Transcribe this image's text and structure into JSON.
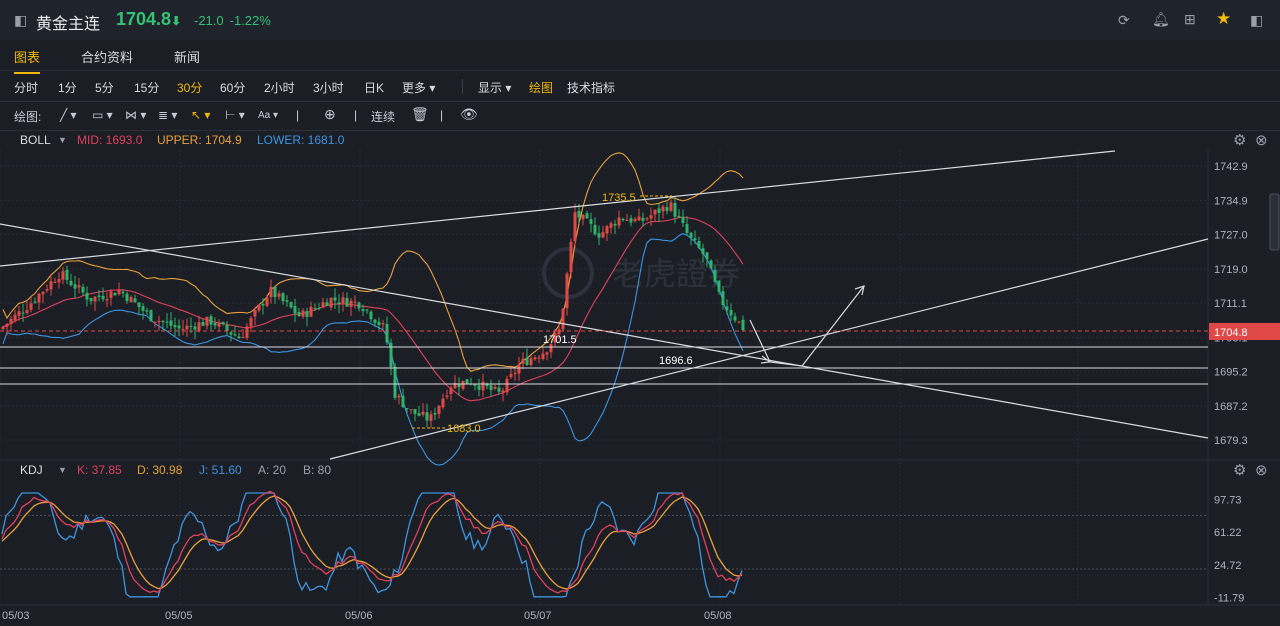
{
  "header": {
    "title": "黄金主连",
    "price": "1704.8",
    "arrow": "⬇",
    "change": "-21.0",
    "change_pct": "-1.22%",
    "icons": [
      "refresh-icon",
      "bell-icon",
      "grid-icon",
      "star-icon",
      "fullscreen-icon"
    ]
  },
  "tabs": [
    {
      "label": "图表",
      "active": true
    },
    {
      "label": "合约资料",
      "active": false
    },
    {
      "label": "新闻",
      "active": false
    }
  ],
  "intervals": [
    "分时",
    "1分",
    "5分",
    "15分",
    "30分",
    "60分",
    "2小时",
    "3小时",
    "日K",
    "更多"
  ],
  "active_interval": "30分",
  "more_arrow": "▾",
  "display_label": "显示",
  "draw_label": "绘图",
  "tech_label": "技术指标",
  "tools": {
    "label": "绘图:",
    "continuous": "连续"
  },
  "boll": {
    "name": "BOLL",
    "mid": "MID: 1693.0",
    "upper": "UPPER: 1704.9",
    "lower": "LOWER: 1681.0",
    "colors": {
      "mid": "#e0405c",
      "upper": "#e8a13a",
      "lower": "#3d95e0"
    }
  },
  "kdj": {
    "name": "KDJ",
    "k": "K: 37.85",
    "d": "D: 30.98",
    "j": "J: 51.60",
    "a": "A: 20",
    "b": "B: 80"
  },
  "price_axis": [
    "1742.9",
    "1734.9",
    "1727.0",
    "1719.0",
    "1711.1",
    "1703.1",
    "1695.2",
    "1687.2",
    "1679.3"
  ],
  "current_price_tag": "1704.8",
  "kdj_axis": [
    "97.73",
    "61.22",
    "24.72",
    "-11.79"
  ],
  "dates": [
    "05/03",
    "05/05",
    "05/06",
    "05/07",
    "05/08"
  ],
  "annotations": {
    "high": "1735.5",
    "low": "1683.0",
    "mid1": "1701.5",
    "mid2": "1696.6"
  },
  "watermark": "老虎證券",
  "colors": {
    "up": "#e04848",
    "down": "#2fb36a",
    "accent": "#f0b90b"
  }
}
